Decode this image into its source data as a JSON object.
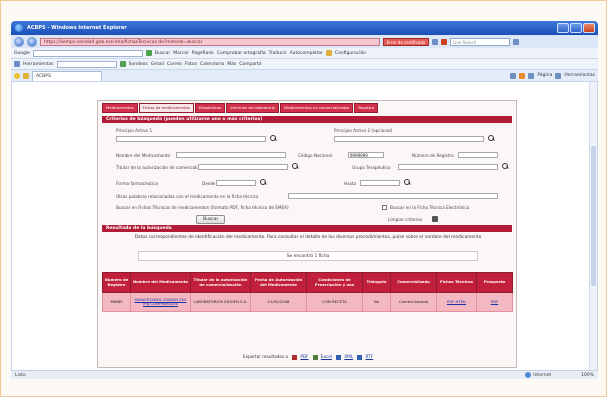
{
  "browser": {
    "title": "ACBPS - Windows Internet Explorer",
    "url": "https://aemps.sanidad.gob.es/cima/fichasTecnicas.do?metodo=buscar",
    "cert_error": "Error de certificado",
    "search_placeholder": "Live Search",
    "tab_title": "ACBPS",
    "toolbar1": {
      "search_label": "Google",
      "buscar": "Buscar",
      "items": [
        "Marcar",
        "PageRank",
        "Comprobar ortografía",
        "Traducir",
        "Autocompletar",
        "Configuración"
      ]
    },
    "toolbar2": {
      "label": "Herramientas",
      "items": [
        "Sondeos",
        "Gmail",
        "Correo",
        "Fotos",
        "Calendario",
        "Más",
        "Compartir"
      ]
    },
    "tab_tools": [
      "Página",
      "Herramientas"
    ],
    "status_left": "Listo",
    "status_zone": "Internet",
    "status_zoom": "100%"
  },
  "page": {
    "tabs": [
      "Medicamentos",
      "Fichas de medicamentos",
      "Estadísticas",
      "Informes de laboratorio",
      "Medicamentos no comercializados",
      "Registro"
    ],
    "criteria_header": "Criterios de búsqueda (pueden utilizarse uno o más criterios)",
    "fields": {
      "principio_activo": "Principio Activo 1",
      "principio_activo_2": "Principio Activo 2 (opcional)",
      "nombre": "Nombre del Medicamento",
      "codigo_nacional": "Código Nacional",
      "codigo_nacional_value": "9999999",
      "registro": "Número de Registro",
      "titular": "Titular de la autorización de comercialización",
      "grupo": "Grupo Terapéutico",
      "forma": "Forma farmacéutica",
      "desde": "Desde",
      "hasta": "Hasta",
      "otras": "Otras palabras relacionadas con el medicamento en la ficha técnica",
      "ref_text": "Buscar en Fichas Técnicas de medicamentos (formato PDF, ficha técnica de EMEA)",
      "chk_label": "Buscar en la Ficha Técnica Electrónica"
    },
    "buttons": {
      "buscar": "Buscar",
      "limpiar": "Limpiar criterios"
    },
    "results_header": "Resultado de la búsqueda",
    "info_text": "Datos correspondientes de identificación del medicamento. Para consultar el detalle de los diversos procedimientos, pulse sobre el nombre del medicamento",
    "results_found": "Se encontró 1 ficha",
    "table": {
      "headers": [
        "Número de Registro",
        "Nombre del Medicamento",
        "Titular de la autorización de comercialización",
        "Fecha de Autorización del Medicamento",
        "Condiciones de Prescripción y uso",
        "Triángulo",
        "Comercializado",
        "Fichas Técnicas",
        "Prospecto"
      ],
      "rows": [
        [
          "69865",
          "PARACETAMOL EDIGEN 500 mg COMPRIMIDOS",
          "LABORATORIOS EDIGEN S.A.",
          "01/02/2008",
          "CON RECETA",
          "No",
          "Comercializado",
          "PDF HTML",
          "PDF"
        ]
      ]
    },
    "export": {
      "label": "Exportar resultados a",
      "formats": [
        "PDF",
        "Excel",
        "XML",
        "RTF"
      ]
    }
  }
}
